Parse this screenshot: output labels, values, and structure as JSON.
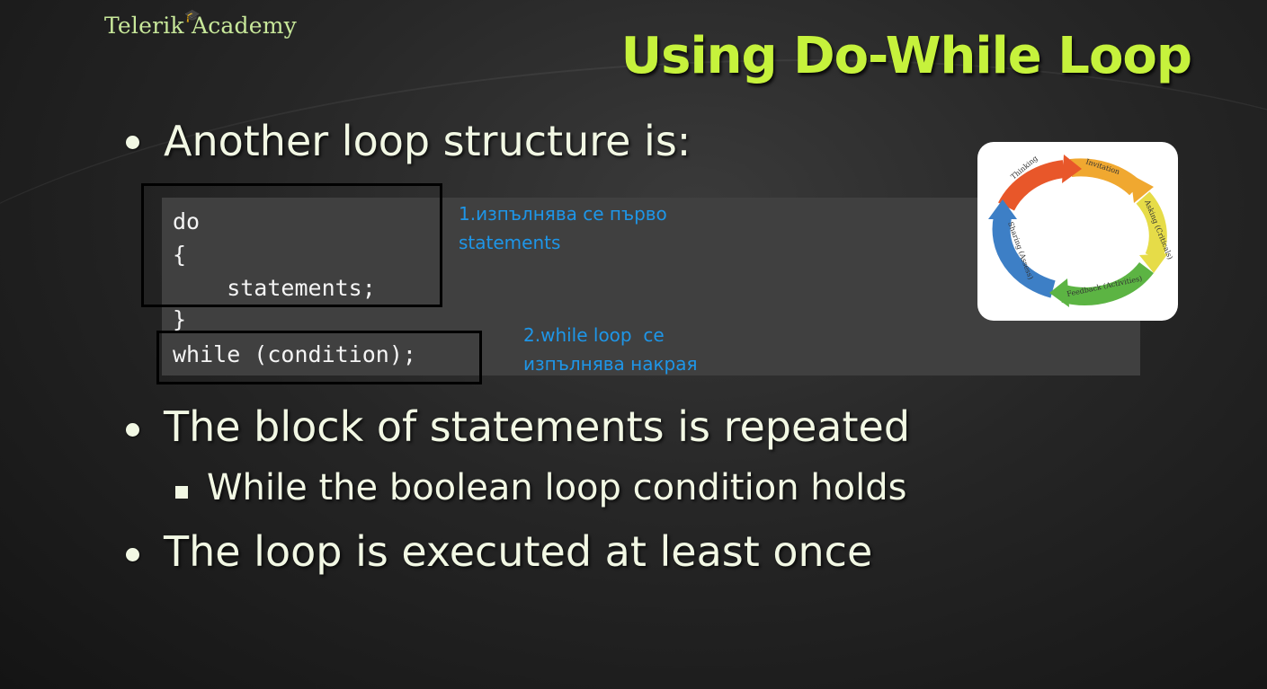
{
  "logo": {
    "text": "Telerik Academy"
  },
  "slide": {
    "title": "Using Do-While Loop"
  },
  "bullets": {
    "b1": "Another loop structure is:",
    "b2": "The block of statements is repeated",
    "b2_sub": "While the boolean loop condition holds",
    "b3": "The loop is executed at least once"
  },
  "code": {
    "line1": "do",
    "line2": "{",
    "line3": "    statements;",
    "line4": "}",
    "line5": "while (condition);"
  },
  "notes": {
    "n1_line1": "1.изпълнява се първо",
    "n1_line2": "statements",
    "n2_line1": "2.while loop  се",
    "n2_line2": "изпълнява накрая"
  },
  "cycle": {
    "labels": [
      "Thinking",
      "Invitation",
      "Asking (Criticals)",
      "Feedback (Activities)",
      "Sharing (Assess)"
    ],
    "colors": [
      "#e8572a",
      "#f0b030",
      "#e8e04a",
      "#5fb544",
      "#3a7fc8"
    ]
  }
}
